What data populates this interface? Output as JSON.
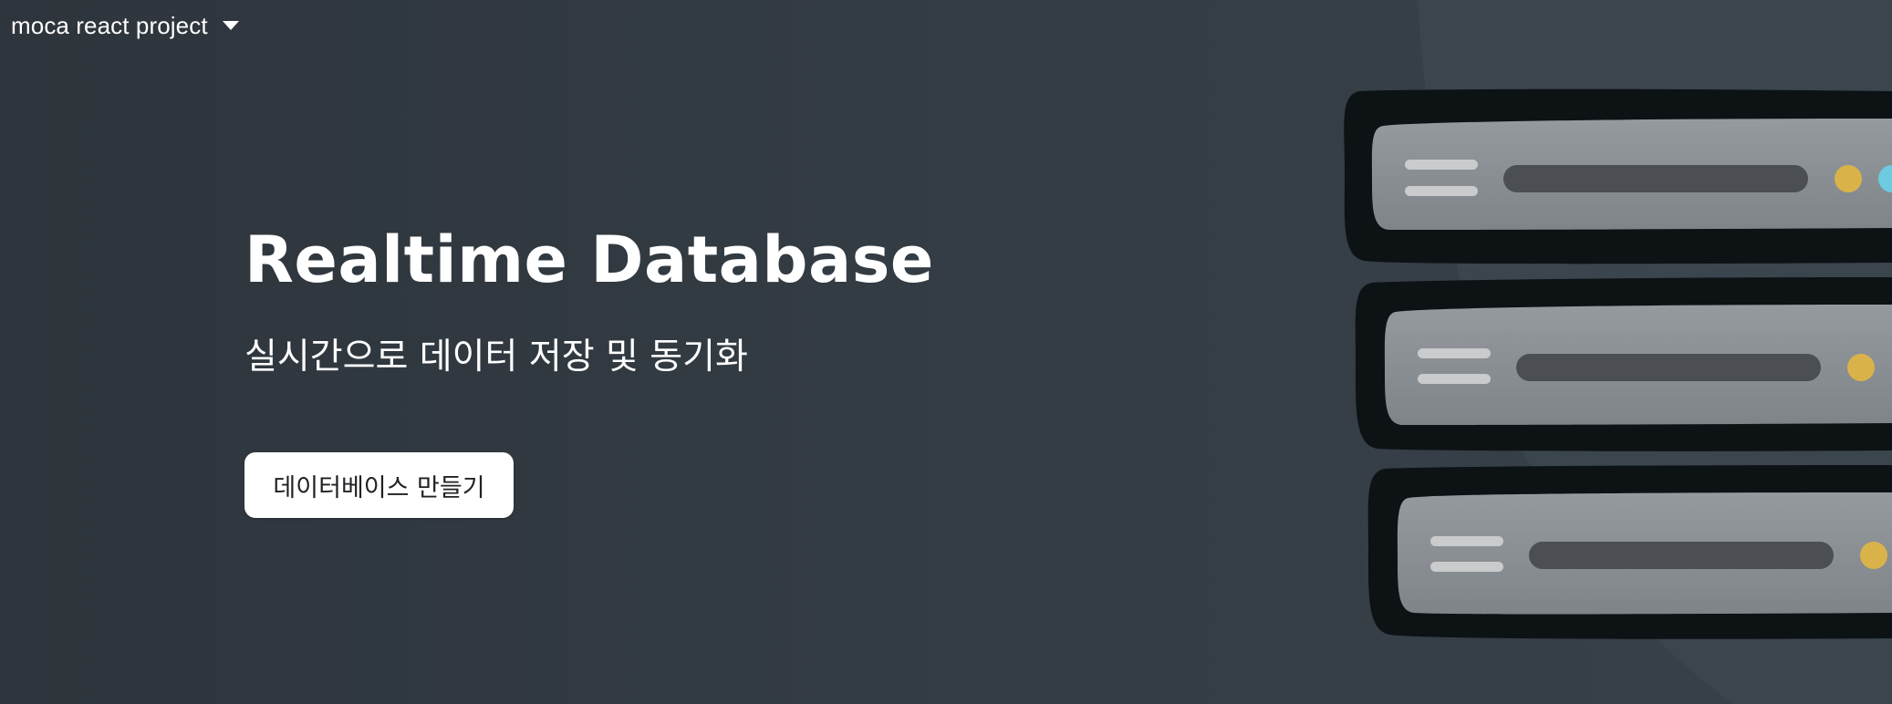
{
  "header": {
    "project_name": "moca react project",
    "dropdown_icon": "caret-down-icon"
  },
  "hero": {
    "title": "Realtime Database",
    "subtitle": "실시간으로 데이터 저장 및 동기화",
    "create_button_label": "데이터베이스 만들기"
  },
  "illustration": {
    "icon": "database-servers-illustration",
    "colors": {
      "background_circle": "#3e4951",
      "server_shell": "#0e1316",
      "server_face": "#8a8f94",
      "slot_bar": "#4b4f53",
      "lines": "#c9cbcc",
      "led_yellow": "#d9b34a",
      "led_cyan": "#6ccbe0"
    }
  },
  "colors": {
    "page_background": "#323a42",
    "button_background": "#ffffff",
    "button_text": "#202124",
    "text": "#ffffff"
  }
}
